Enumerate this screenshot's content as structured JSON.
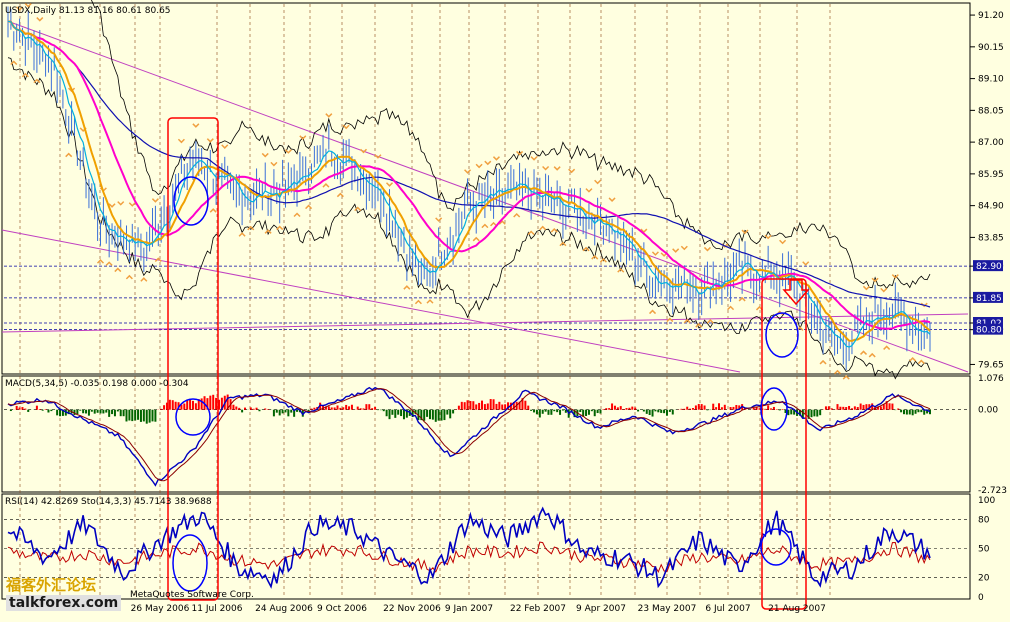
{
  "symbol_header": "USDX,Daily  81.13 81.16 80.61 80.65",
  "price_levels": [
    "91.20",
    "90.15",
    "89.10",
    "88.05",
    "87.00",
    "85.95",
    "84.90",
    "83.85",
    "82.90",
    "81.85",
    "81.02",
    "80.80",
    "79.65"
  ],
  "price_boxes": [
    "82.90",
    "81.85",
    "81.02",
    "80.80"
  ],
  "macd": {
    "header": "MACD(5,34,5) -0.035 0.198 0.000 -0.304",
    "scale_labels": [
      "1.076",
      "0.00",
      "-2.723"
    ]
  },
  "rsi": {
    "header": "RSI(14) 42.8269  Sto(14,3,3) 45.7143  38.9688",
    "scale_labels": [
      "100",
      "80",
      "50",
      "20",
      "0"
    ]
  },
  "date_labels": [
    "26 May 2006",
    "11 Jul 2006",
    "24 Aug 2006",
    "9 Oct 2006",
    "22 Nov 2006",
    "9 Jan 2007",
    "22 Feb 2007",
    "9 Apr 2007",
    "23 May 2007",
    "6 Jul 2007",
    "21 Aug 2007"
  ],
  "watermark": {
    "cn": "福客外汇论坛",
    "en": "talkforex.com",
    "credit": "MetaQuotes Software Corp."
  },
  "colors": {
    "background": "#FFFFE0",
    "bars": "#3a6fd8",
    "ma_fast": "#F0A000",
    "ma_mid": "#FF00CC",
    "ma_slow": "#1010B0",
    "bands": "#000000",
    "trend": "#C040C0",
    "annotation": "#FF0000",
    "circle": "#0000FF",
    "macd_pos": "#FF0000",
    "macd_neg": "#006400",
    "rsi": "#0000C0",
    "sto": "#C00000",
    "fractal": "#F0A040"
  },
  "chart_data": [
    {
      "type": "line",
      "title": "USDX,Daily  81.13 81.16 80.61 80.65",
      "x": [
        "26 May 2006",
        "11 Jul 2006",
        "24 Aug 2006",
        "9 Oct 2006",
        "22 Nov 2006",
        "9 Jan 2007",
        "22 Feb 2007",
        "9 Apr 2007",
        "23 May 2007",
        "6 Jul 2007",
        "21 Aug 2007"
      ],
      "ylim": [
        79.4,
        91.5
      ],
      "series": [
        {
          "values": [
            84.2,
            86.5,
            85.2,
            86.8,
            82.4,
            85.4,
            84.3,
            82.2,
            82.8,
            80.2,
            80.65
          ]
        }
      ],
      "ohlc_last": {
        "open": 81.13,
        "high": 81.16,
        "low": 80.61,
        "close": 80.65
      }
    },
    {
      "type": "bar",
      "title": "MACD(5,34,5) -0.035 0.198 0.000 -0.304",
      "ylim": [
        -2.723,
        1.076
      ],
      "values": [
        0.2,
        0.35,
        -0.3,
        -0.9,
        -2.5,
        -1.4,
        0.4,
        0.5,
        -0.1,
        0.3,
        0.8,
        -0.2,
        -1.6,
        -0.5,
        0.6,
        0.1,
        -0.6,
        -0.2,
        -0.8,
        -0.4,
        0.1,
        0.3,
        -0.7,
        -0.2,
        0.5,
        -0.035
      ]
    },
    {
      "type": "line",
      "title": "RSI(14) 42.8269  Sto(14,3,3) 45.7143  38.9688",
      "ylim": [
        0,
        100
      ],
      "series": [
        {
          "values": [
            70,
            40,
            75,
            25,
            60,
            85,
            30,
            20,
            75,
            70,
            40,
            20,
            80,
            60,
            90,
            45,
            40,
            20,
            60,
            30,
            80,
            20,
            30,
            70,
            45
          ]
        },
        {
          "values": [
            60,
            45,
            55,
            40,
            55,
            65,
            42,
            35,
            60,
            62,
            45,
            30,
            60,
            55,
            68,
            48,
            42,
            30,
            50,
            40,
            62,
            35,
            40,
            65,
            42.8
          ]
        }
      ]
    }
  ]
}
